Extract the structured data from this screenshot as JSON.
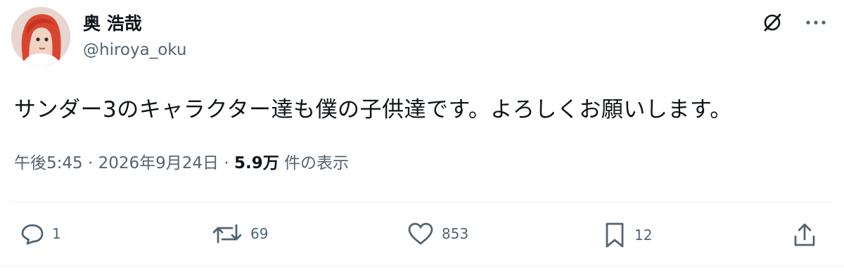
{
  "author": {
    "display_name": "奥 浩哉",
    "handle": "@hiroya_oku",
    "avatar_icon": "avatar"
  },
  "post": {
    "text": "サンダー3のキャラクター達も僕の子供達です。よろしくお願いします。",
    "time": "午後5:45",
    "separator": "·",
    "date": "2026年9月24日",
    "views_count": "5.9万",
    "views_label": "件の表示"
  },
  "top_actions": {
    "grok_icon": "grok-icon",
    "more_icon": "more-icon"
  },
  "actions": {
    "reply_count": "1",
    "repost_count": "69",
    "like_count": "853",
    "bookmark_count": "12"
  },
  "colors": {
    "text": "#0f1419",
    "secondary": "#536471",
    "divider": "#eff3f4"
  }
}
